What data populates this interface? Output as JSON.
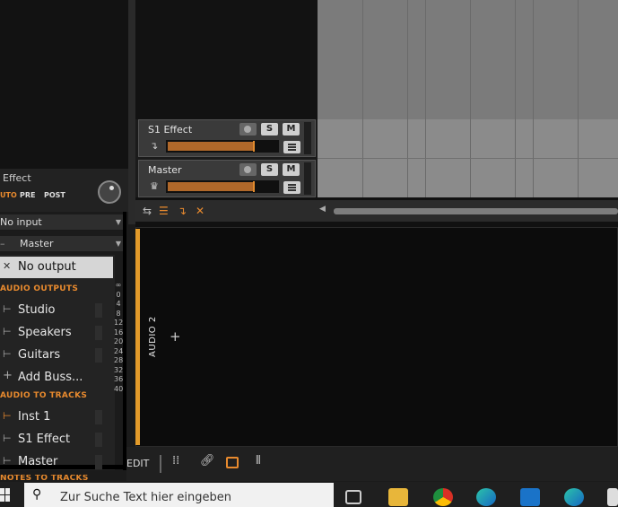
{
  "inspector": {
    "effect_name": "Effect",
    "mode_auto": "UTO",
    "mode_pre": "PRE",
    "mode_post": "POST",
    "input_select": "No input",
    "output_select": "Master"
  },
  "output_dropdown": {
    "selected": "No output",
    "sections": [
      {
        "header": "AUDIO OUTPUTS",
        "items": [
          "Studio",
          "Speakers",
          "Guitars",
          "Add Buss..."
        ]
      },
      {
        "header": "AUDIO TO TRACKS",
        "items": [
          "Inst 1",
          "S1 Effect",
          "Master"
        ]
      }
    ],
    "cut_header": "NOTES TO TRACKS"
  },
  "meter_scale": [
    "∞",
    "0",
    "4",
    "8",
    "12",
    "16",
    "20",
    "24",
    "28",
    "32",
    "36",
    "40"
  ],
  "tracks": [
    {
      "name": "S1 Effect",
      "solo": "S",
      "mute": "M",
      "volume": 0.78
    },
    {
      "name": "Master",
      "solo": "S",
      "mute": "M",
      "volume": 0.78
    }
  ],
  "device_panel": {
    "track_label": "AUDIO 2",
    "add_symbol": "+"
  },
  "bottom_toolbar": {
    "edit_label": "EDIT"
  },
  "taskbar": {
    "search_placeholder": "Zur Suche Text hier eingeben"
  },
  "colors": {
    "accent_orange": "#e39b2a",
    "section_header": "#e88a2e",
    "fader_fill": "#b0682a"
  }
}
